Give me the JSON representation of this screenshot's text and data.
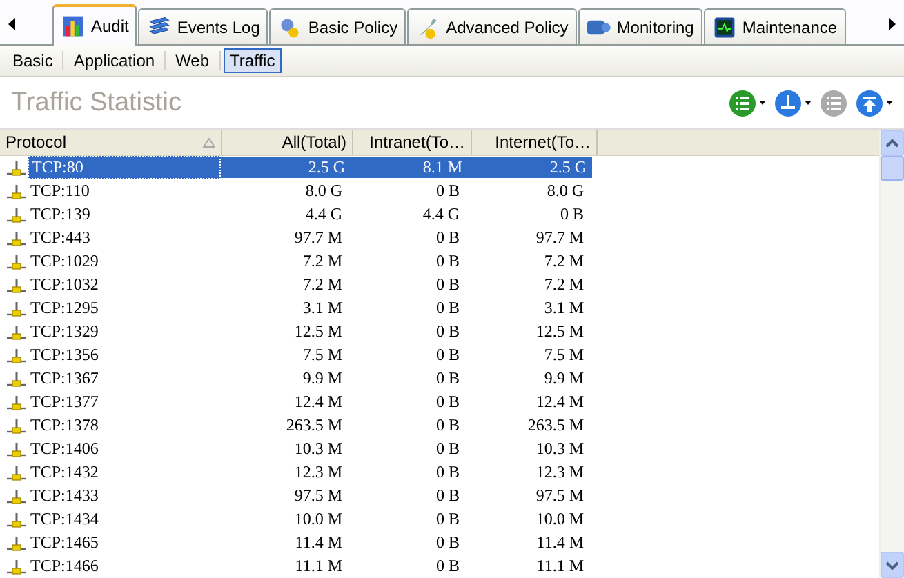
{
  "tabs": [
    {
      "label": "Audit",
      "selected": true
    },
    {
      "label": "Events Log",
      "selected": false
    },
    {
      "label": "Basic Policy",
      "selected": false
    },
    {
      "label": "Advanced Policy",
      "selected": false
    },
    {
      "label": "Monitoring",
      "selected": false
    },
    {
      "label": "Maintenance",
      "selected": false
    }
  ],
  "subtabs": [
    {
      "label": "Basic",
      "selected": false
    },
    {
      "label": "Application",
      "selected": false
    },
    {
      "label": "Web",
      "selected": false
    },
    {
      "label": "Traffic",
      "selected": true
    }
  ],
  "panel": {
    "title": "Traffic Statistic"
  },
  "toolbar": [
    {
      "disabled": false,
      "dropdown": true
    },
    {
      "disabled": false,
      "dropdown": true
    },
    {
      "disabled": true,
      "dropdown": false
    },
    {
      "disabled": false,
      "dropdown": true
    }
  ],
  "table": {
    "columns": [
      "Protocol",
      "All(Total)",
      "Intranet(To…",
      "Internet(To…"
    ],
    "rows": [
      {
        "cells": [
          "TCP:80",
          "2.5 G",
          "8.1 M",
          "2.5 G"
        ],
        "selected": true
      },
      {
        "cells": [
          "TCP:110",
          "8.0 G",
          "0 B",
          "8.0 G"
        ],
        "selected": false
      },
      {
        "cells": [
          "TCP:139",
          "4.4 G",
          "4.4 G",
          "0 B"
        ],
        "selected": false
      },
      {
        "cells": [
          "TCP:443",
          "97.7 M",
          "0 B",
          "97.7 M"
        ],
        "selected": false
      },
      {
        "cells": [
          "TCP:1029",
          "7.2 M",
          "0 B",
          "7.2 M"
        ],
        "selected": false
      },
      {
        "cells": [
          "TCP:1032",
          "7.2 M",
          "0 B",
          "7.2 M"
        ],
        "selected": false
      },
      {
        "cells": [
          "TCP:1295",
          "3.1 M",
          "0 B",
          "3.1 M"
        ],
        "selected": false
      },
      {
        "cells": [
          "TCP:1329",
          "12.5 M",
          "0 B",
          "12.5 M"
        ],
        "selected": false
      },
      {
        "cells": [
          "TCP:1356",
          "7.5 M",
          "0 B",
          "7.5 M"
        ],
        "selected": false
      },
      {
        "cells": [
          "TCP:1367",
          "9.9 M",
          "0 B",
          "9.9 M"
        ],
        "selected": false
      },
      {
        "cells": [
          "TCP:1377",
          "12.4 M",
          "0 B",
          "12.4 M"
        ],
        "selected": false
      },
      {
        "cells": [
          "TCP:1378",
          "263.5 M",
          "0 B",
          "263.5 M"
        ],
        "selected": false
      },
      {
        "cells": [
          "TCP:1406",
          "10.3 M",
          "0 B",
          "10.3 M"
        ],
        "selected": false
      },
      {
        "cells": [
          "TCP:1432",
          "12.3 M",
          "0 B",
          "12.3 M"
        ],
        "selected": false
      },
      {
        "cells": [
          "TCP:1433",
          "97.5 M",
          "0 B",
          "97.5 M"
        ],
        "selected": false
      },
      {
        "cells": [
          "TCP:1434",
          "10.0 M",
          "0 B",
          "10.0 M"
        ],
        "selected": false
      },
      {
        "cells": [
          "TCP:1465",
          "11.4 M",
          "0 B",
          "11.4 M"
        ],
        "selected": false
      },
      {
        "cells": [
          "TCP:1466",
          "11.1 M",
          "0 B",
          "11.1 M"
        ],
        "selected": false
      }
    ]
  }
}
